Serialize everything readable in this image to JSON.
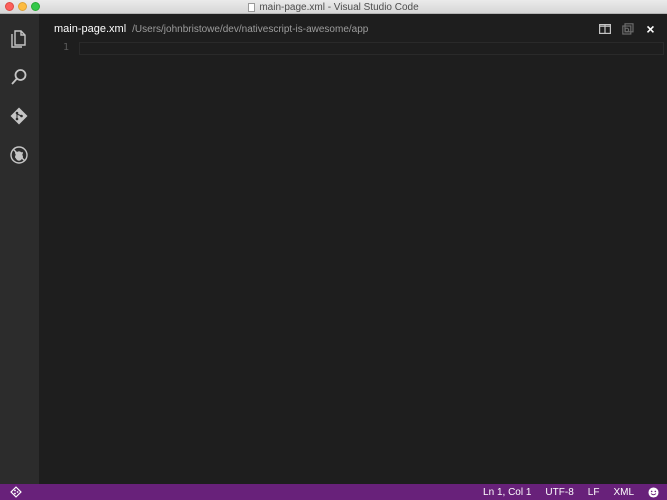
{
  "window": {
    "title": "main-page.xml - Visual Studio Code"
  },
  "activity_bar": {
    "items": [
      {
        "name": "explorer",
        "icon": "files-icon"
      },
      {
        "name": "search",
        "icon": "search-icon"
      },
      {
        "name": "git",
        "icon": "git-icon"
      },
      {
        "name": "debug",
        "icon": "debug-icon"
      }
    ]
  },
  "editor": {
    "filename": "main-page.xml",
    "path": "/Users/johnbristowe/dev/nativescript-is-awesome/app",
    "line_number": "1",
    "close_glyph": "×"
  },
  "statusbar": {
    "position": "Ln 1, Col 1",
    "encoding": "UTF-8",
    "eol": "LF",
    "language": "XML"
  },
  "colors": {
    "statusbar": "#68217a",
    "editor_bg": "#1e1e1e",
    "activity_bg": "#2c2c2c"
  }
}
